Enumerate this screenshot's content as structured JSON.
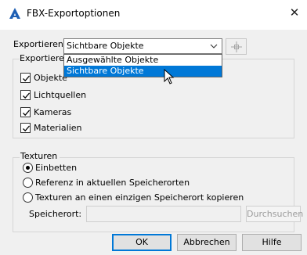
{
  "window": {
    "title": "FBX-Exportoptionen",
    "close_glyph": "✕"
  },
  "export": {
    "label": "Exportieren",
    "selected": "Sichtbare Objekte",
    "options": [
      "Ausgewählte Objekte",
      "Sichtbare Objekte"
    ],
    "highlighted_index": 1
  },
  "group_export": {
    "title": "Exportieren",
    "items": [
      {
        "label": "Objekte",
        "checked": true
      },
      {
        "label": "Lichtquellen",
        "checked": true
      },
      {
        "label": "Kameras",
        "checked": true
      },
      {
        "label": "Materialien",
        "checked": true
      }
    ]
  },
  "group_textures": {
    "title": "Texturen",
    "options": [
      {
        "label": "Einbetten",
        "selected": true
      },
      {
        "label": "Referenz in aktuellen Speicherorten",
        "selected": false
      },
      {
        "label": "Texturen an einen einzigen Speicherort kopieren",
        "selected": false
      }
    ],
    "path_label": "Speicherort:",
    "path_value": "",
    "browse_label": "Durchsuchen"
  },
  "buttons": {
    "ok": "OK",
    "cancel": "Abbrechen",
    "help": "Hilfe"
  },
  "colors": {
    "accent": "#0078d7",
    "panel": "#f0f0f0",
    "icon": "#1e5fb4"
  }
}
